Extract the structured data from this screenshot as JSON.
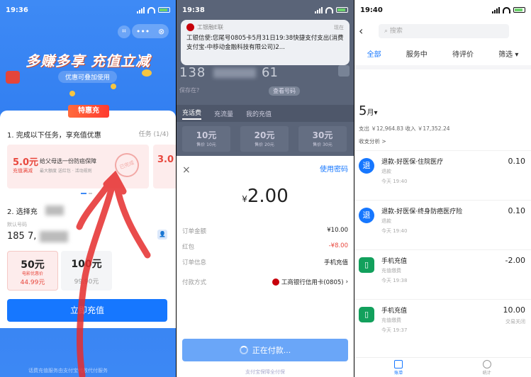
{
  "panel1": {
    "time": "19:36",
    "banner_title": "多赚多享 充值立减",
    "banner_sub": "优惠可叠加使用",
    "tag": "特惠充",
    "task_header": "1. 完成以下任务，享充值优惠",
    "task_count": "任务 (1/4)",
    "task_value": "5.0元",
    "task_value_sub": "充值满减",
    "task_value2": "3.0",
    "task_desc": "给父母选一份防癌保障",
    "task_desc2": "最大额度 送红包 · 活动规则",
    "stamp": "已完成",
    "select_header": "2. 选择充",
    "number_label": "默认号码",
    "number_value": "185 7,",
    "amounts": [
      {
        "value": "50元",
        "sub": "电影优惠价",
        "price": "44.99元"
      },
      {
        "value": "100元",
        "sub": "",
        "price": "99.90元"
      }
    ],
    "buy_button": "立即充值",
    "footer": "话费充值服务由支付宝代收代付服务"
  },
  "panel2": {
    "time": "19:38",
    "notif_app": "工银融E联",
    "notif_time": "现在",
    "notif_text": "工银信使:您尾号0805卡5月31日19:38快捷支付支出(消费支付宝-中移动金融科技有限公司)2...",
    "phone_start": "138",
    "phone_end": "61",
    "label_left": "保存在?",
    "label_right": "查看号码",
    "tabs": [
      "充话费",
      "充流量",
      "我的充值"
    ],
    "amounts": [
      {
        "value": "10元",
        "sub": "售价 10元"
      },
      {
        "value": "20元",
        "sub": "售价 20元"
      },
      {
        "value": "30元",
        "sub": "售价 30元"
      }
    ],
    "close": "×",
    "use_password": "使用密码",
    "currency": "¥",
    "amount": "2.00",
    "rows": [
      {
        "label": "订单金额",
        "value": "¥10.00"
      },
      {
        "label": "红包",
        "value": "-¥8.00"
      },
      {
        "label": "订单信息",
        "value": "手机充值"
      }
    ],
    "pay_method_label": "付款方式",
    "pay_method_value": "工商银行信用卡(0805)",
    "pay_button": "正在付款...",
    "footer": "支付宝保障全付保"
  },
  "panel3": {
    "time": "19:40",
    "back": "‹",
    "search_placeholder": "搜索",
    "filters": [
      "全部",
      "服务中",
      "待评价",
      "筛选 ▾"
    ],
    "month": "5",
    "month_unit": "月▾",
    "summary": "支出 ￥12,964.83   收入 ￥17,352.24",
    "analysis": "收支分析 >",
    "transactions": [
      {
        "icon": "退",
        "title": "退款-好医保·住院医疗",
        "sub": "退款",
        "time": "今天 19:40",
        "amount": "0.10",
        "status": ""
      },
      {
        "icon": "退",
        "title": "退款-好医保·终身防癌医疗险",
        "sub": "退款",
        "time": "今天 19:40",
        "amount": "0.10",
        "status": ""
      },
      {
        "icon": "▯",
        "title": "手机充值",
        "sub": "充值缴费",
        "time": "今天 19:38",
        "amount": "-2.00",
        "status": ""
      },
      {
        "icon": "▯",
        "title": "手机充值",
        "sub": "充值缴费",
        "time": "今天 19:37",
        "amount": "10.00",
        "status": "交易关闭"
      }
    ],
    "tabbar": [
      "账单",
      "统计"
    ]
  }
}
